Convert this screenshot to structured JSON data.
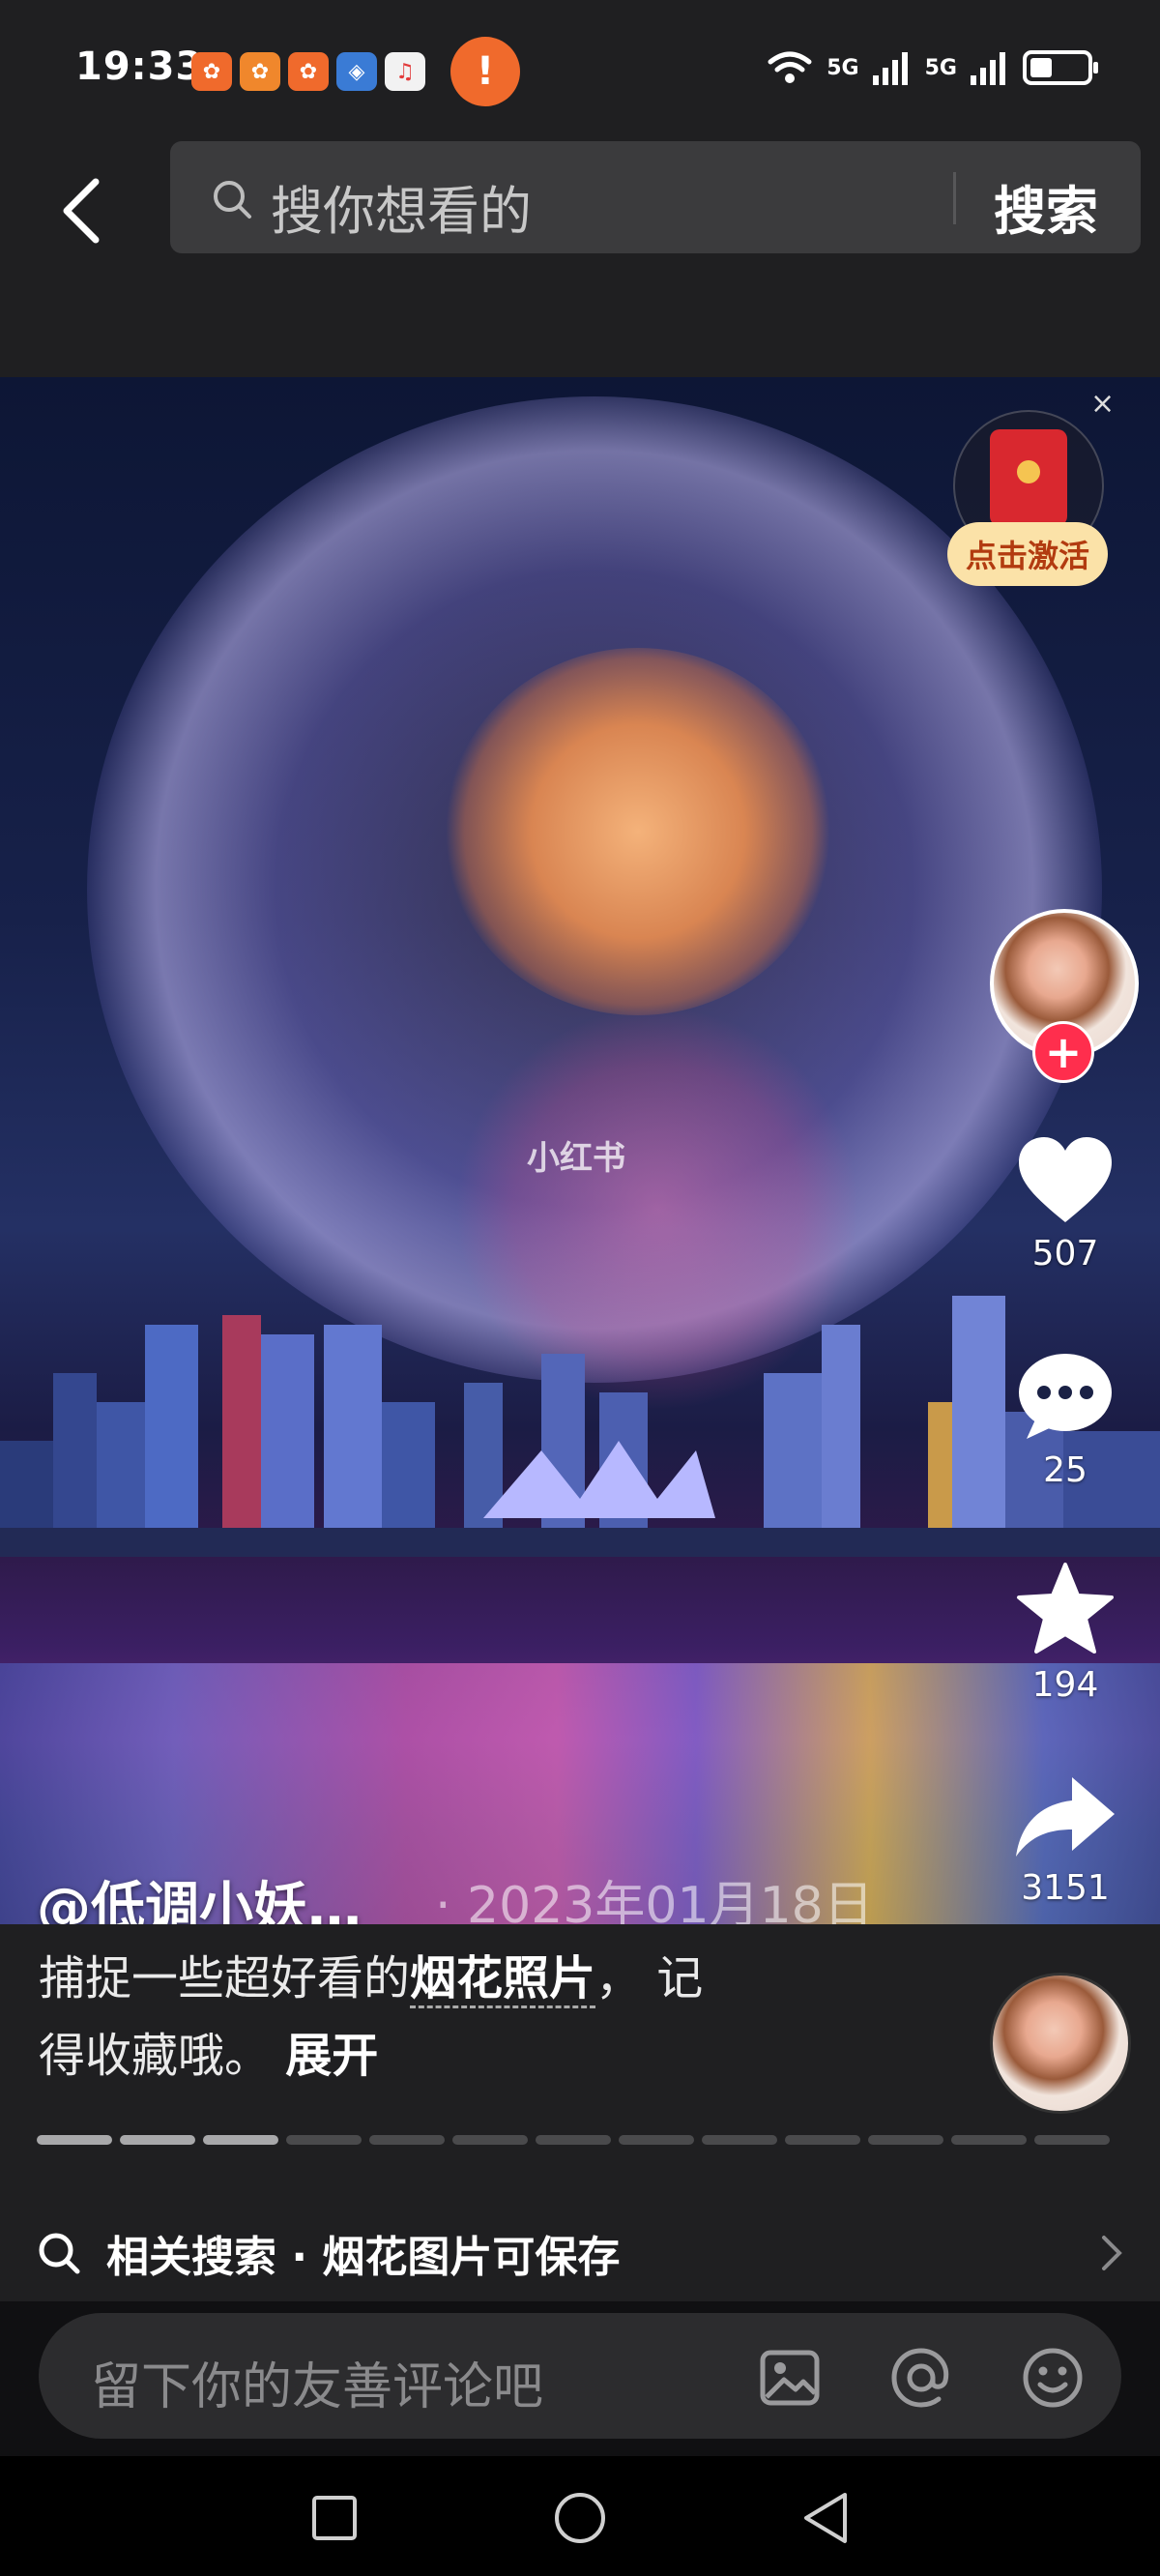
{
  "status_bar": {
    "time": "19:33",
    "signal_1": "5G",
    "signal_2": "5G",
    "warning_glyph": "!"
  },
  "search": {
    "placeholder": "搜你想看的",
    "button_label": "搜索"
  },
  "photo": {
    "watermark": "小红书"
  },
  "red_packet": {
    "label": "点击激活",
    "close": "×"
  },
  "actions": {
    "likes": "507",
    "comments": "25",
    "favorites": "194",
    "shares": "3151"
  },
  "post": {
    "author": "@低调小妖…",
    "date": "· 2023年01月18日",
    "desc_prefix": "捕捉一些超好看的",
    "desc_highlight": "烟花照片",
    "desc_suffix": "，  记",
    "desc_line2": "得收藏哦。",
    "expand_label": "展开"
  },
  "progress": {
    "total": 13,
    "completed": 3
  },
  "related_search": {
    "label": "相关搜索 · 烟花图片可保存"
  },
  "comment": {
    "placeholder": "留下你的友善评论吧"
  },
  "icons": {
    "back": "chevron-left-icon",
    "search": "search-icon",
    "like": "heart-icon",
    "comment": "chat-bubble-icon",
    "favorite": "star-icon",
    "share": "share-arrow-icon",
    "image": "image-icon",
    "mention": "at-icon",
    "emoji": "emoji-icon"
  },
  "colors": {
    "follow_button": "#ff2e4d",
    "warning": "#f06a2c",
    "red_packet_label_bg": "#fbe2a8"
  }
}
